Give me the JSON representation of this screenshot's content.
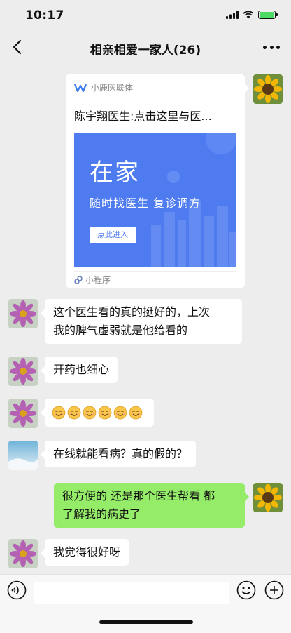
{
  "status": {
    "time": "10:17"
  },
  "nav": {
    "title": "相亲相爱一家人(26)"
  },
  "mini_program": {
    "source_name": "小鹿医联体",
    "title": "陈宇翔医生:点击这里与医...",
    "banner_big": "在家",
    "banner_sub": "随时找医生  复诊调方",
    "banner_button": "点此进入",
    "footer_label": "小程序",
    "banner_color": "#4e7bf0"
  },
  "messages": [
    {
      "side": "left",
      "avatar": "flower-avatar",
      "text_lines": [
        "这个医生看的真的挺好的，上次",
        "我的脾气虚弱就是他给看的"
      ]
    },
    {
      "side": "left",
      "avatar": "flower-avatar",
      "text": "开药也细心"
    },
    {
      "side": "left",
      "avatar": "flower-avatar",
      "emoji_count": 6,
      "emoji": "smile-emoji"
    },
    {
      "side": "left",
      "avatar": "sky-avatar",
      "text": "在线就能看病？真的假的？"
    },
    {
      "side": "right",
      "avatar": "sunflower-avatar",
      "text_lines": [
        "很方便的 还是那个医生帮看 都",
        "了解我的病史了"
      ]
    },
    {
      "side": "left",
      "avatar": "flower-avatar",
      "text": "我觉得很好呀"
    }
  ],
  "colors": {
    "background": "#ededed",
    "self_bubble": "#95ec69",
    "other_bubble": "#ffffff"
  }
}
